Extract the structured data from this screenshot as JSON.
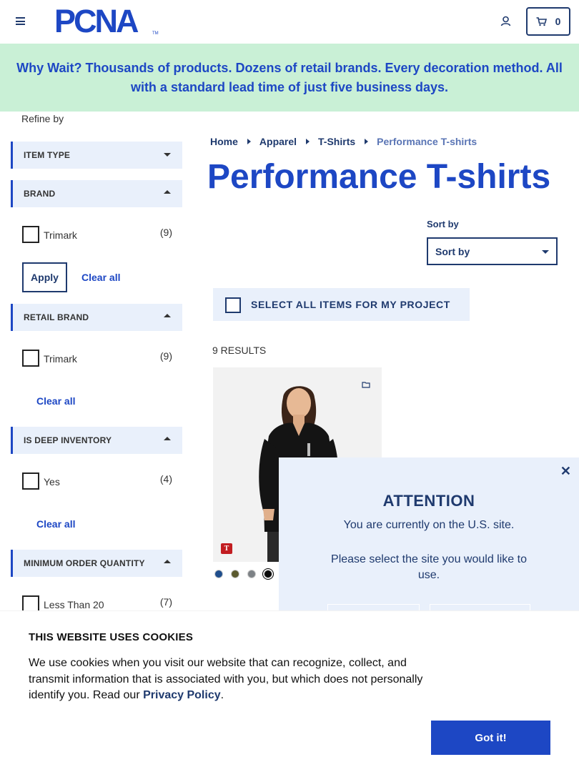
{
  "header": {
    "logo_text": "PCNA",
    "logo_tm": "TM",
    "cart_count": "0"
  },
  "promo": {
    "text": "Why Wait? Thousands of products. Dozens of retail brands. Every decoration method. All with a standard lead time of just five business days."
  },
  "sidebar": {
    "refine_label": "Refine by",
    "facets": {
      "item_type": {
        "label": "ITEM TYPE"
      },
      "brand": {
        "label": "BRAND",
        "option": "Trimark",
        "count": "(9)",
        "apply": "Apply",
        "clear": "Clear all"
      },
      "retail_brand": {
        "label": "RETAIL BRAND",
        "option": "Trimark",
        "count": "(9)",
        "clear": "Clear all"
      },
      "deep_inventory": {
        "label": "IS DEEP INVENTORY",
        "option": "Yes",
        "count": "(4)",
        "clear": "Clear all"
      },
      "min_order": {
        "label": "MINIMUM ORDER QUANTITY",
        "option": "Less Than 20",
        "count": "(7)"
      }
    }
  },
  "breadcrumb": [
    "Home",
    "Apparel",
    "T-Shirts",
    "Performance T-shirts"
  ],
  "page_title": "Performance T-shirts",
  "sort": {
    "label": "Sort by",
    "selected": "Sort by"
  },
  "select_all": "SELECT ALL ITEMS FOR MY PROJECT",
  "results_count": "9 RESULTS",
  "product": {
    "brand_badge": "T",
    "swatch_colors": [
      "#1f4e8c",
      "#5b5a2e",
      "#7d8286",
      "#0a0a0a"
    ]
  },
  "modal": {
    "close": "✕",
    "title": "ATTENTION",
    "message": "You are currently on the U.S. site.",
    "message2": "Please select the site you would like to use."
  },
  "cookie": {
    "title": "THIS WEBSITE USES COOKIES",
    "text": "We use cookies when you visit our website that can recognize, collect, and transmit information that is associated with you, but which does not personally identify you. Read our ",
    "link": "Privacy Policy",
    "end": ".",
    "button": "Got it!"
  },
  "colors": {
    "brand_blue": "#1d47c4",
    "navy": "#1f3a6e",
    "promo_bg": "#c9f0d6",
    "facet_bg": "#e9f0fb"
  }
}
